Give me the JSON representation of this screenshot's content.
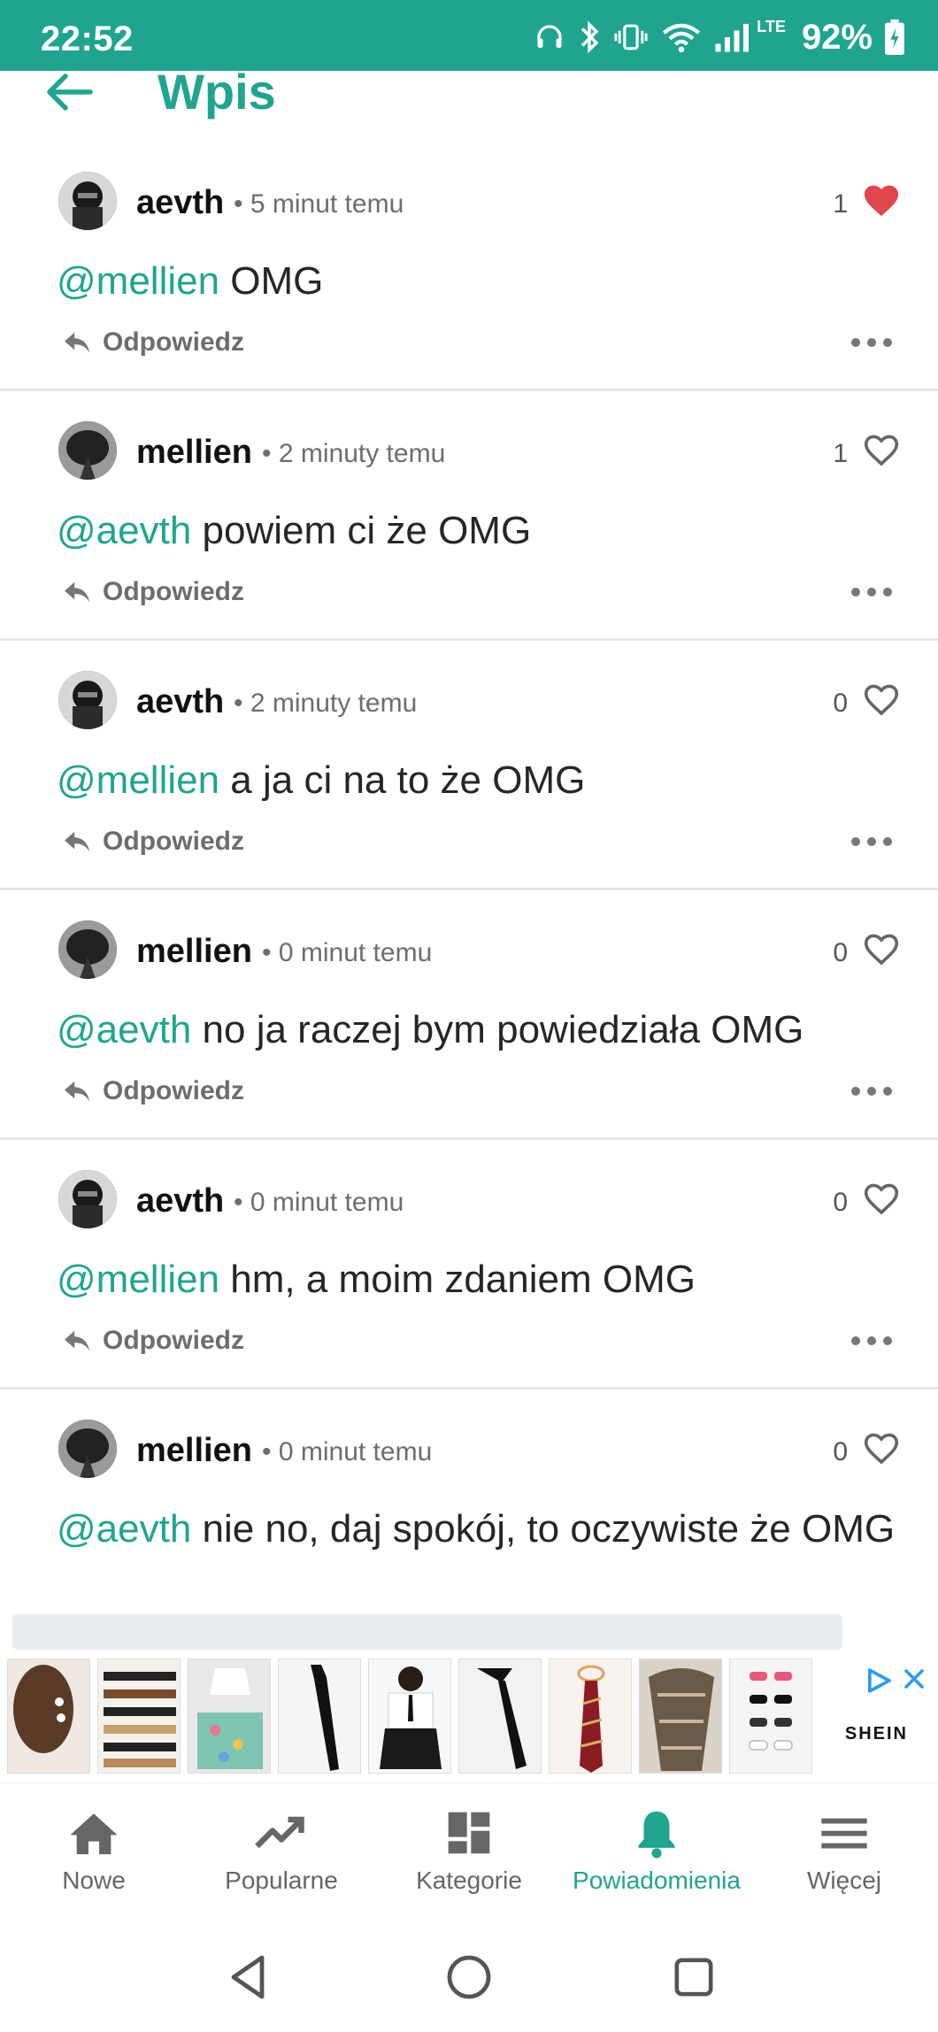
{
  "status_bar": {
    "time": "22:52",
    "battery": "92%",
    "network": "LTE",
    "icons": [
      "headset-icon",
      "bluetooth-icon",
      "vibrate-icon",
      "wifi-icon",
      "signal-icon",
      "battery-icon"
    ]
  },
  "header": {
    "title": "Wpis",
    "back_icon": "arrow-left-icon"
  },
  "colors": {
    "accent": "#1fa58f",
    "liked": "#e0474c"
  },
  "comments": [
    {
      "user": "aevth",
      "time": "5 minut temu",
      "likes": "1",
      "liked": true,
      "mention": "@mellien",
      "text": " OMG",
      "reply": "Odpowiedz"
    },
    {
      "user": "mellien",
      "time": "2 minuty temu",
      "likes": "1",
      "liked": false,
      "mention": "@aevth",
      "text": " powiem ci że OMG",
      "reply": "Odpowiedz"
    },
    {
      "user": "aevth",
      "time": "2 minuty temu",
      "likes": "0",
      "liked": false,
      "mention": "@mellien",
      "text": " a ja ci na to że OMG",
      "reply": "Odpowiedz"
    },
    {
      "user": "mellien",
      "time": "0 minut temu",
      "likes": "0",
      "liked": false,
      "mention": "@aevth",
      "text": " no ja raczej bym powiedziała OMG",
      "reply": "Odpowiedz"
    },
    {
      "user": "aevth",
      "time": "0 minut temu",
      "likes": "0",
      "liked": false,
      "mention": "@mellien",
      "text": " hm, a moim zdaniem OMG",
      "reply": "Odpowiedz"
    },
    {
      "user": "mellien",
      "time": "0 minut temu",
      "likes": "0",
      "liked": false,
      "mention": "@aevth",
      "text": " nie no, daj spokój, to oczywiste że OMG",
      "reply": "Odpowiedz"
    }
  ],
  "ad": {
    "brand": "SHEIN"
  },
  "bottom_nav": [
    {
      "label": "Nowe",
      "icon": "home-icon",
      "active": false
    },
    {
      "label": "Popularne",
      "icon": "trending-icon",
      "active": false
    },
    {
      "label": "Kategorie",
      "icon": "dashboard-icon",
      "active": false
    },
    {
      "label": "Powiadomienia",
      "icon": "bell-icon",
      "active": true
    },
    {
      "label": "Więcej",
      "icon": "menu-icon",
      "active": false
    }
  ]
}
